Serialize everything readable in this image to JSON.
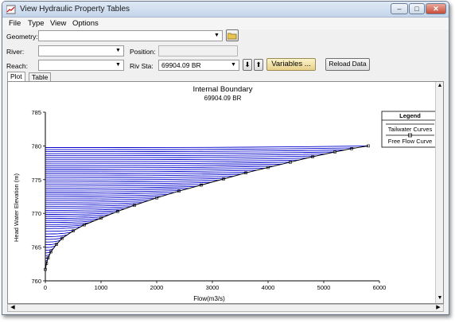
{
  "window": {
    "title": "View Hydraulic Property Tables"
  },
  "menu": [
    "File",
    "Type",
    "View",
    "Options"
  ],
  "form": {
    "geometry_label": "Geometry:",
    "river_label": "River:",
    "position_label": "Position:",
    "reach_label": "Reach:",
    "rivsta_label": "Riv Sta:",
    "rivsta_value": "69904.09 BR",
    "variables_button": "Variables ...",
    "reload_button": "Reload Data"
  },
  "tabs": [
    "Plot",
    "Table"
  ],
  "colors": {
    "curves": "#0000cc",
    "free_flow": "#000000",
    "titlebar": "#c4d5ea"
  },
  "chart_data": {
    "type": "line",
    "title": "Internal Boundary",
    "subtitle": "69904.09 BR",
    "xlabel": "Flow(m3/s)",
    "ylabel": "Head Water Elevation (m)",
    "xlim": [
      0,
      6000
    ],
    "ylim": [
      760,
      785
    ],
    "xticks": [
      0,
      1000,
      2000,
      3000,
      4000,
      5000,
      6000
    ],
    "yticks": [
      760,
      765,
      770,
      775,
      780,
      785
    ],
    "legend_title": "Legend",
    "legend_position": "top-right",
    "series": [
      {
        "name": "Tailwater Curves",
        "description_values": "family of ~60 nearly horizontal curves from the free flow curve to x=0"
      },
      {
        "name": "Free Flow Curve",
        "x": [
          0,
          20,
          50,
          100,
          200,
          300,
          500,
          700,
          1000,
          1300,
          1600,
          2000,
          2400,
          2800,
          3200,
          3600,
          4000,
          4400,
          4800,
          5200,
          5500,
          5800
        ],
        "y": [
          761.7,
          762.6,
          763.4,
          764.3,
          765.4,
          766.3,
          767.4,
          768.3,
          769.3,
          770.3,
          771.2,
          772.3,
          773.3,
          774.2,
          775.1,
          776.0,
          776.8,
          777.6,
          778.4,
          779.1,
          779.6,
          780.0
        ]
      }
    ],
    "tailwater_levels": [
      762.0,
      762.4,
      762.8,
      763.2,
      763.6,
      764.0,
      764.4,
      764.8,
      765.2,
      765.6,
      766.0,
      766.4,
      766.8,
      767.2,
      767.6,
      768.0,
      768.3,
      768.6,
      768.9,
      769.2,
      769.5,
      769.8,
      770.1,
      770.4,
      770.7,
      771.0,
      771.3,
      771.6,
      771.9,
      772.2,
      772.5,
      772.8,
      773.1,
      773.4,
      773.7,
      774.0,
      774.3,
      774.6,
      774.9,
      775.2,
      775.5,
      775.8,
      776.1,
      776.4,
      776.7,
      777.0,
      777.3,
      777.6,
      777.9,
      778.2,
      778.5,
      778.8,
      779.1,
      779.4,
      779.7,
      780.0
    ]
  }
}
